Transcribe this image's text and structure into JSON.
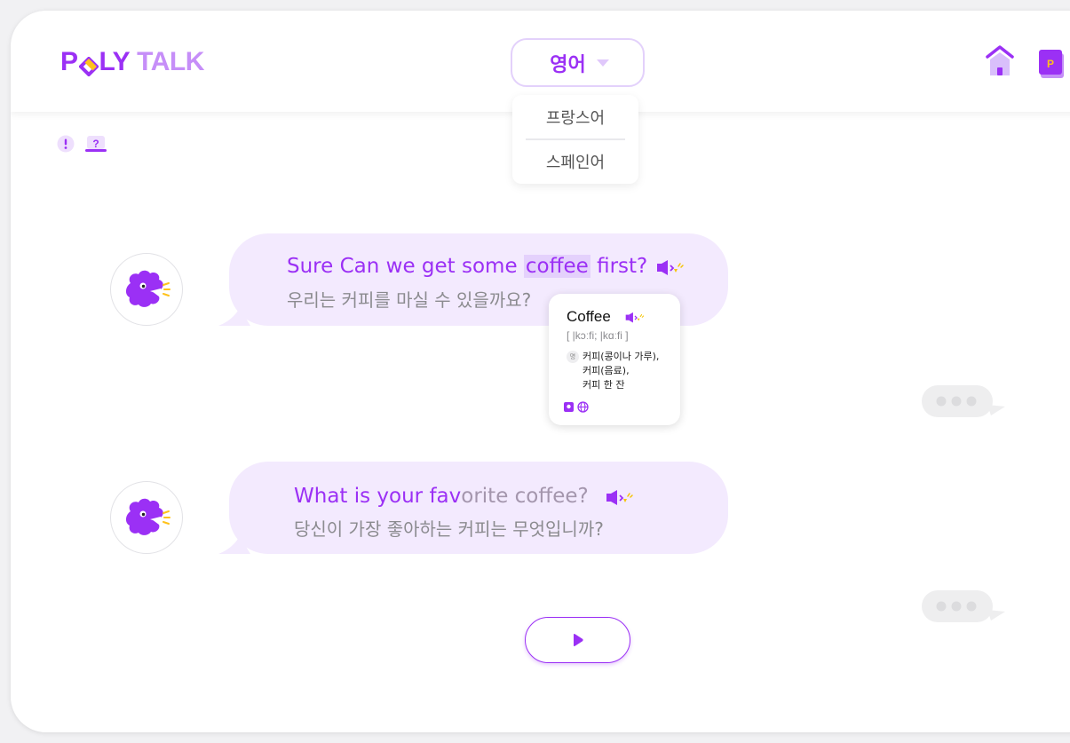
{
  "header": {
    "logo": {
      "p": "P",
      "ly": "LY",
      "talk": "TALK"
    },
    "language": {
      "selected": "영어",
      "options": [
        "프랑스어",
        "스페인어"
      ]
    },
    "icons": [
      "home-icon",
      "vocabulary-book-icon"
    ]
  },
  "tools": [
    "alert-icon",
    "help-icon"
  ],
  "colors": {
    "accent": "#9b30f5",
    "bubble": "#f3eafe",
    "highlight": "#e4d1fc",
    "speaker_yellow": "#f5c400"
  },
  "messages": [
    {
      "en_pre": "Sure Can we get some ",
      "en_highlight": "coffee",
      "en_post": " first?",
      "ko": "우리는 커피를 마실 수 있을까요?"
    },
    {
      "en_read": "What is your fav",
      "en_unread": "orite coffee?",
      "ko": "당신이 가장 좋아하는 커피는 무엇입니까?"
    }
  ],
  "dictionary": {
    "word": "Coffee",
    "pronunciation": "[ |kɔːfi; |kɑːfi ]",
    "pos": "명",
    "definitions": [
      "커피(콩이나 가루),",
      "커피(음료),",
      "커피 한 잔"
    ]
  }
}
